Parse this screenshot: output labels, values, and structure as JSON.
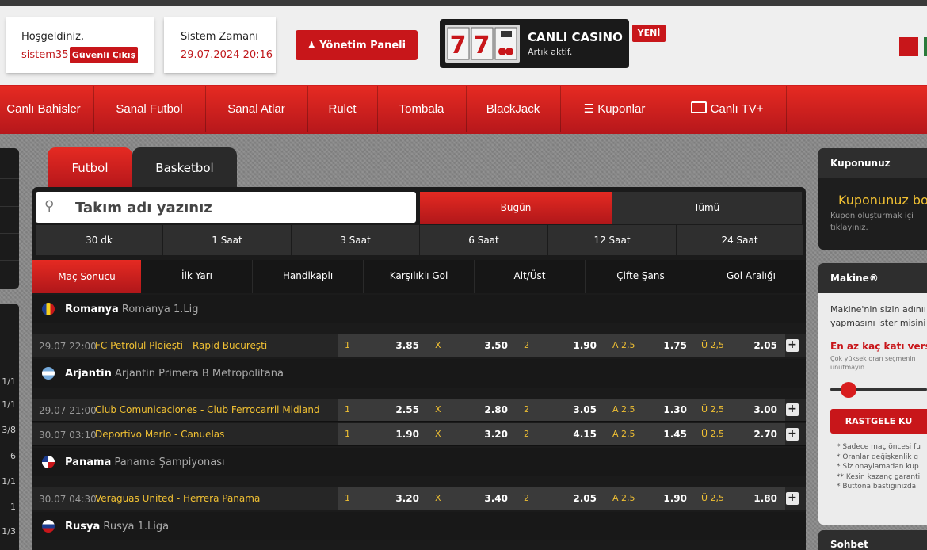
{
  "header": {
    "welcome_label": "Hoşgeldiniz,",
    "username": "sistem35",
    "logout_label": "Güvenli Çıkış",
    "time_label": "Sistem Zamanı",
    "time_value": "29.07.2024 20:16",
    "admin_label": "Yönetim Paneli",
    "casino_title": "CANLI CASINO",
    "casino_sub": "Artık aktif.",
    "new_badge": "YENİ"
  },
  "nav": {
    "items": [
      "Canlı Bahisler",
      "Sanal Futbol",
      "Sanal Atlar",
      "Rulet",
      "Tombala",
      "BlackJack",
      "Kuponlar",
      "Canlı TV+"
    ]
  },
  "sport_tabs": [
    "Futbol",
    "Basketbol"
  ],
  "search": {
    "placeholder": "Takım adı yazınız"
  },
  "day_filters": [
    "Bugün",
    "Tümü"
  ],
  "time_filters": [
    "30 dk",
    "1 Saat",
    "3 Saat",
    "6 Saat",
    "12 Saat",
    "24 Saat"
  ],
  "market_tabs": [
    "Maç Sonucu",
    "İlk Yarı",
    "Handikaplı",
    "Karşılıklı Gol",
    "Alt/Üst",
    "Çifte Şans",
    "Gol Aralığı"
  ],
  "odds_labels": {
    "home": "1",
    "draw": "X",
    "away": "2",
    "over_under_a": "A 2,5",
    "over_under_u": "Ü 2,5"
  },
  "groups": [
    {
      "country": "Romanya",
      "league": "Romanya 1.Lig",
      "flag": "romania-flag",
      "matches": [
        {
          "time": "29.07 22:00",
          "teams": "FC Petrolul Ploiești - Rapid București",
          "o1": "3.85",
          "ox": "3.50",
          "o2": "1.90",
          "oa": "1.75",
          "ou": "2.05"
        }
      ]
    },
    {
      "country": "Arjantin",
      "league": "Arjantin Primera B Metropolitana",
      "flag": "argentina-flag",
      "matches": [
        {
          "time": "29.07 21:00",
          "teams": "Club Comunicaciones - Club Ferrocarril Midland",
          "o1": "2.55",
          "ox": "2.80",
          "o2": "3.05",
          "oa": "1.30",
          "ou": "3.00"
        },
        {
          "time": "30.07 03:10",
          "teams": "Deportivo Merlo - Canuelas",
          "o1": "1.90",
          "ox": "3.20",
          "o2": "4.15",
          "oa": "1.45",
          "ou": "2.70"
        }
      ]
    },
    {
      "country": "Panama",
      "league": "Panama Şampiyonası",
      "flag": "panama-flag",
      "matches": [
        {
          "time": "30.07 04:30",
          "teams": "Veraguas United - Herrera Panama",
          "o1": "3.20",
          "ox": "3.40",
          "o2": "2.05",
          "oa": "1.90",
          "ou": "1.80"
        }
      ]
    },
    {
      "country": "Rusya",
      "league": "Rusya 1.Liga",
      "flag": "russia-flag",
      "matches": []
    }
  ],
  "left_counts": [
    "1/1",
    "1/1",
    "3/8",
    "6",
    "1/1",
    "1",
    "1/3"
  ],
  "coupon": {
    "title": "Kuponunuz",
    "empty_title": "Kuponunuz bo",
    "empty_sub1": "Kupon oluşturmak içi",
    "empty_sub2": "tıklayınız."
  },
  "machine": {
    "title": "Makine®",
    "desc1": "Makine'nin sizin adınıı",
    "desc2": "yapmasını ister misini",
    "min_label": "En az kaç katı versi",
    "hint1": "Çok yüksek oran seçmenin",
    "hint2": "unutmayın.",
    "slider_value": 0.12,
    "random_button": "RASTGELE KU",
    "notes": [
      "* Sadece maç öncesi fu",
      "* Oranlar değişkenlik g",
      "* Siz onaylamadan kup",
      "** Kesin kazanç garanti",
      "* Buttona bastığınızda"
    ]
  },
  "chat": {
    "title": "Sohbet"
  },
  "colors": {
    "accent": "#c8161a",
    "odds_label": "#f0c033",
    "team": "#f0c033"
  }
}
